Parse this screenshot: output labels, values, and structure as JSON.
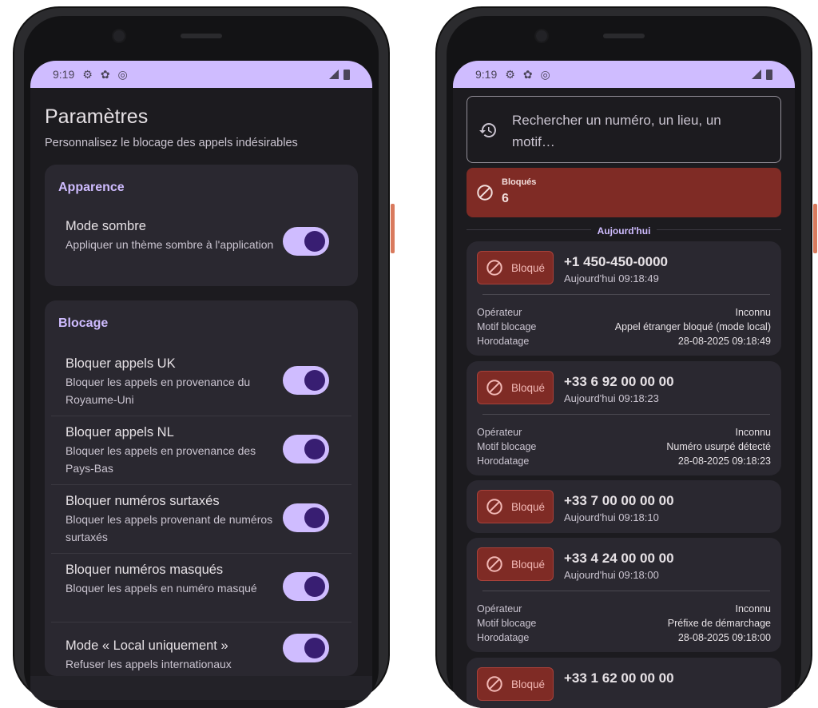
{
  "status": {
    "time": "9:19"
  },
  "settings": {
    "title": "Paramètres",
    "subtitle": "Personnalisez le blocage des appels indésirables",
    "sections": [
      {
        "header": "Apparence",
        "items": [
          {
            "title": "Mode sombre",
            "desc": "Appliquer un thème sombre à l'application",
            "on": true
          }
        ]
      },
      {
        "header": "Blocage",
        "items": [
          {
            "title": "Bloquer appels UK",
            "desc": "Bloquer les appels en provenance du Royaume-Uni",
            "on": true
          },
          {
            "title": "Bloquer appels NL",
            "desc": "Bloquer les appels en provenance des Pays-Bas",
            "on": true
          },
          {
            "title": "Bloquer numéros surtaxés",
            "desc": "Bloquer les appels provenant de numéros surtaxés",
            "on": true
          },
          {
            "title": "Bloquer numéros masqués",
            "desc": "Bloquer les appels en numéro masqué",
            "on": true
          },
          {
            "title": "Mode « Local uniquement »",
            "desc": "Refuser les appels internationaux",
            "on": true
          }
        ]
      }
    ]
  },
  "calllog": {
    "search_placeholder": "Rechercher un numéro, un lieu, un motif…",
    "blocked_label": "Bloqués",
    "blocked_count": "6",
    "day_label": "Aujourd'hui",
    "chip_label": "Bloqué",
    "detail_labels": {
      "operator": "Opérateur",
      "reason": "Motif blocage",
      "timestamp": "Horodatage"
    },
    "calls": [
      {
        "number": "+1 450-450-0000",
        "when": "Aujourd'hui 09:18:49",
        "operator": "Inconnu",
        "reason": "Appel étranger bloqué (mode local)",
        "timestamp": "28-08-2025 09:18:49"
      },
      {
        "number": "+33 6 92 00 00 00",
        "when": "Aujourd'hui 09:18:23",
        "operator": "Inconnu",
        "reason": "Numéro usurpé détecté",
        "timestamp": "28-08-2025 09:18:23"
      },
      {
        "number": "+33 7 00 00 00 00",
        "when": "Aujourd'hui 09:18:10"
      },
      {
        "number": "+33 4 24 00 00 00",
        "when": "Aujourd'hui 09:18:00",
        "operator": "Inconnu",
        "reason": "Préfixe de démarchage",
        "timestamp": "28-08-2025 09:18:00"
      },
      {
        "number": "+33 1 62 00 00 00"
      }
    ]
  },
  "colors": {
    "accent": "#cfbcff",
    "blocked": "#7f2b25",
    "surface": "#2a2830",
    "background": "#1c1b1f"
  }
}
